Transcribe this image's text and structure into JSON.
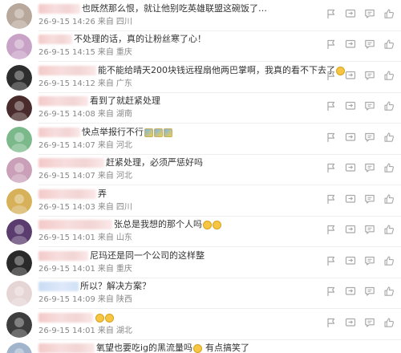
{
  "comments": [
    {
      "text": "也既然那么恨，就让他别吃英雄联盟这碗饭了…",
      "date": "26-9-15",
      "time": "14:26",
      "from": "来自",
      "location": "四川",
      "emojis": [],
      "avatar_color": "#b8a89c"
    },
    {
      "text": "不处理的话，真的让粉丝寒了心！",
      "date": "26-9-15",
      "time": "14:15",
      "from": "来自",
      "location": "重庆",
      "emojis": [],
      "avatar_color": "#c9a3c7"
    },
    {
      "text": "能不能给晴天200块钱远程扇他两巴掌啊，我真的看不下去了",
      "date": "26-9-15",
      "time": "14:12",
      "from": "来自",
      "location": "广东",
      "emojis": [
        "face"
      ],
      "avatar_color": "#2d2d2d"
    },
    {
      "text": "看到了就赶紧处理",
      "date": "26-9-15",
      "time": "14:08",
      "from": "来自",
      "location": "湖南",
      "emojis": [],
      "avatar_color": "#4a2b2b"
    },
    {
      "text": "快点举报行不行",
      "date": "26-9-15",
      "time": "14:07",
      "from": "来自",
      "location": "河北",
      "emojis": [
        "flag",
        "flag",
        "flag"
      ],
      "avatar_color": "#7cb98a"
    },
    {
      "text": "赶紧处理，必须严惩好吗",
      "date": "26-9-15",
      "time": "14:07",
      "from": "来自",
      "location": "河北",
      "emojis": [],
      "avatar_color": "#caa0b8"
    },
    {
      "text": "弄",
      "date": "26-9-15",
      "time": "14:03",
      "from": "来自",
      "location": "四川",
      "emojis": [],
      "avatar_color": "#d6b15a"
    },
    {
      "text": "张总是我想的那个人吗",
      "date": "26-9-15",
      "time": "14:01",
      "from": "来自",
      "location": "山东",
      "emojis": [
        "face",
        "face"
      ],
      "avatar_color": "#5a3d6e"
    },
    {
      "text": "尼玛还是同一个公司的这样整",
      "date": "26-9-15",
      "time": "14:01",
      "from": "来自",
      "location": "重庆",
      "emojis": [],
      "avatar_color": "#2a2a2a"
    },
    {
      "text": "所以？解决方案？",
      "date": "26-9-15",
      "time": "14:09",
      "from": "来自",
      "location": "陕西",
      "emojis": [],
      "avatar_color": "#e6d5d5"
    },
    {
      "text": "",
      "date": "26-9-15",
      "time": "14:01",
      "from": "来自",
      "location": "湖北",
      "emojis": [
        "face",
        "face"
      ],
      "avatar_color": "#3d3d3d"
    },
    {
      "text": "氧望也要吃ig的黑流量吗",
      "text_tail": "有点搞笑了",
      "date": "",
      "time": "",
      "from": "",
      "location": "",
      "emojis": [
        "face"
      ],
      "avatar_color": "#a0b4cc"
    }
  ],
  "icons": {
    "report": "flag-icon",
    "share": "share-icon",
    "reply": "reply-icon",
    "like": "thumbs-up-icon"
  },
  "colors": {
    "meta_text": "#888888",
    "icon": "#a9a9a9",
    "divider": "#eeeeee"
  }
}
